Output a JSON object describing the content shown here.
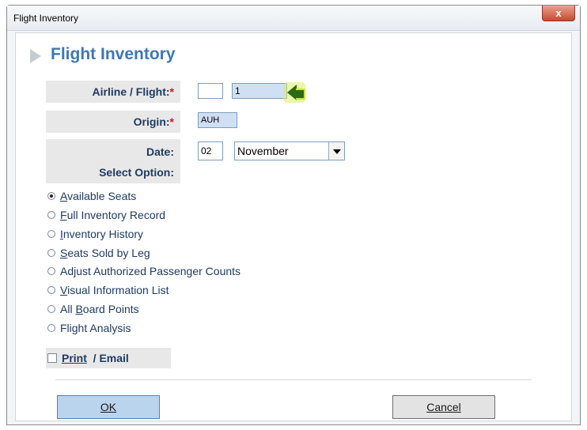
{
  "window": {
    "title": "Flight Inventory",
    "close_glyph": "x"
  },
  "heading": "Flight Inventory",
  "fields": {
    "airline_flight": {
      "label": "Airline / Flight:",
      "required": "*",
      "airline_value": "",
      "flight_value": "1"
    },
    "origin": {
      "label": "Origin:",
      "required": "*",
      "value": "AUH"
    },
    "date": {
      "label": "Date:",
      "day_value": "02",
      "month_value": "November"
    },
    "select_option_label": "Select Option:"
  },
  "options": [
    {
      "mnemonic": "A",
      "rest": "vailable Seats",
      "selected": true
    },
    {
      "mnemonic": "F",
      "rest": "ull Inventory Record",
      "selected": false
    },
    {
      "mnemonic": "I",
      "rest": "nventory History",
      "selected": false
    },
    {
      "mnemonic": "S",
      "rest": "eats Sold by Leg",
      "selected": false
    },
    {
      "pre": "Ad",
      "mnemonic": "j",
      "rest": "ust Authorized Passenger Counts",
      "selected": false
    },
    {
      "mnemonic": "V",
      "rest": "isual Information List",
      "selected": false
    },
    {
      "pre": "All ",
      "mnemonic": "B",
      "rest": "oard Points",
      "selected": false
    },
    {
      "pre": "Flight Analysis",
      "mnemonic": "",
      "rest": "",
      "selected": false
    }
  ],
  "print_email": {
    "mnemonic": "P",
    "rest": "rint",
    "suffix": "  / Email",
    "checked": false
  },
  "buttons": {
    "ok": "OK",
    "cancel": "Cancel"
  },
  "colors": {
    "heading": "#3d78b6",
    "label_text": "#1e3b63",
    "ok_bg": "#bad4ee",
    "arrow": "#2a6b12"
  },
  "icons": {
    "heading": "chevron-right-icon",
    "go": "arrow-left-icon"
  }
}
